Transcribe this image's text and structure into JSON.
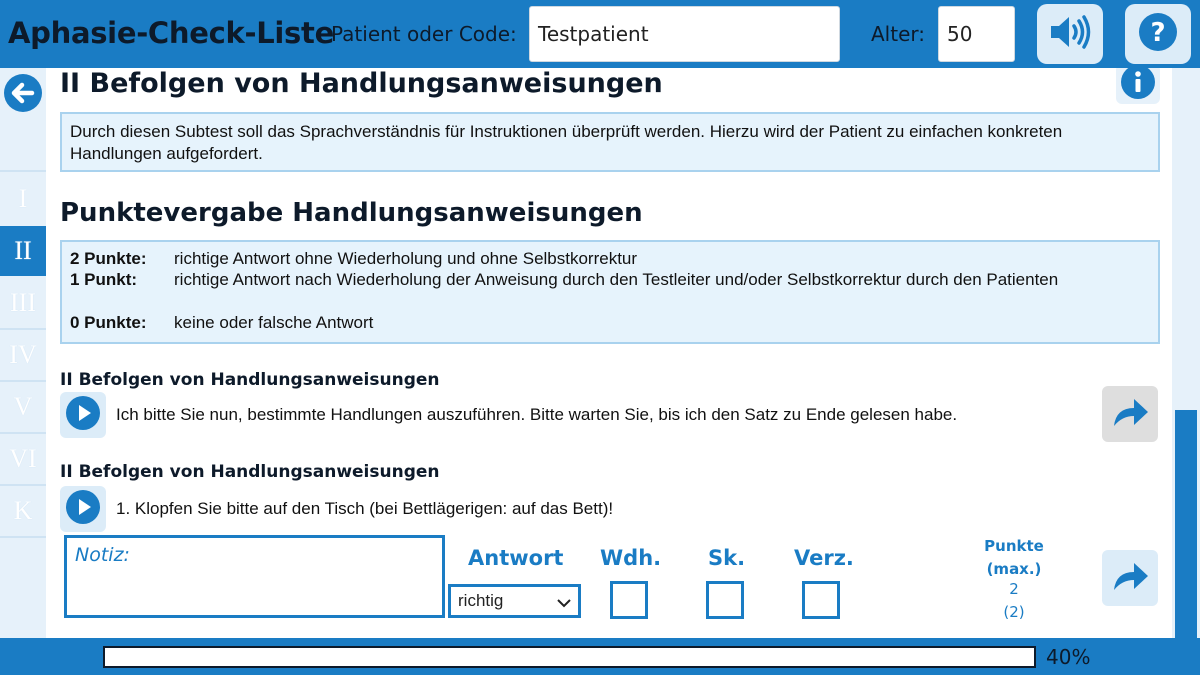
{
  "header": {
    "app_title": "Aphasie-Check-Liste",
    "patient_label": "Patient oder Code:",
    "patient_value": "Testpatient",
    "age_label": "Alter:",
    "age_value": "50"
  },
  "sidebar": {
    "items": [
      {
        "label": "I",
        "active": false
      },
      {
        "label": "II",
        "active": true
      },
      {
        "label": "III",
        "active": false
      },
      {
        "label": "IV",
        "active": false
      },
      {
        "label": "V",
        "active": false
      },
      {
        "label": "VI",
        "active": false
      },
      {
        "label": "K",
        "active": false
      }
    ]
  },
  "main": {
    "title": "II Befolgen von Handlungsanweisungen",
    "description": "Durch diesen Subtest soll das Sprachverständnis für Instruktionen überprüft werden. Hierzu wird der Patient zu einfachen konkreten Handlungen aufgefordert.",
    "scoring_title": "Punktevergabe Handlungsanweisungen",
    "scoring": [
      {
        "points": "2 Punkte:",
        "desc": "richtige Antwort ohne Wiederholung und ohne Selbstkorrektur"
      },
      {
        "points": "1 Punkt:",
        "desc": "richtige Antwort nach Wiederholung der Anweisung durch den Testleiter und/oder Selbstkorrektur durch den Patienten"
      },
      {
        "points": "0 Punkte:",
        "desc": "keine oder falsche Antwort"
      }
    ],
    "section_a": {
      "heading": "II Befolgen von Handlungsanweisungen",
      "text": "Ich bitte Sie nun, bestimmte Handlungen auszuführen. Bitte warten Sie, bis ich den Satz zu Ende gelesen habe."
    },
    "section_b": {
      "heading": "II Befolgen von Handlungsanweisungen",
      "text": "1. Klopfen Sie bitte auf den Tisch (bei Bettlägerigen: auf das Bett)!"
    },
    "item": {
      "notes_placeholder": "Notiz:",
      "answer_label": "Antwort",
      "answer_value": "richtig",
      "wdh_label": "Wdh.",
      "sk_label": "Sk.",
      "verz_label": "Verz.",
      "points_label": "Punkte (max.)",
      "points_value": "2",
      "points_max": "(2)"
    }
  },
  "footer": {
    "progress_percent": 40,
    "progress_text": "40%"
  },
  "colors": {
    "accent": "#1a7cc4",
    "panel": "#e6f3fc",
    "button_bg": "#dcecf8"
  },
  "icons": [
    "speaker-icon",
    "help-icon",
    "back-arrow-icon",
    "info-icon",
    "play-icon",
    "forward-arrow-icon",
    "chevron-down-icon"
  ]
}
